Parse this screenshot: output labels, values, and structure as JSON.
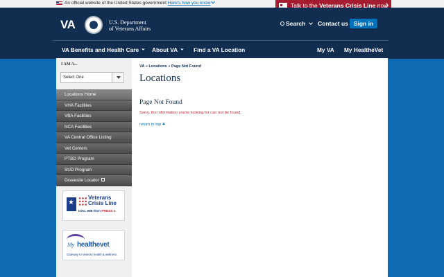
{
  "gov_banner": {
    "text": "An official website of the United States government",
    "link": "Here's how you know"
  },
  "crisis_line": {
    "prefix": "Talk to the",
    "bold": "Veterans Crisis Line",
    "suffix": "now"
  },
  "header": {
    "logo": "VA",
    "dept_line1": "U.S. Department",
    "dept_line2": "of Veterans Affairs",
    "search": "Search",
    "contact": "Contact us",
    "signin": "Sign in"
  },
  "nav": {
    "benefits": "VA Benefits and Health Care",
    "about": "About VA",
    "find": "Find a VA Location",
    "myva": "My VA",
    "myhealthevet": "My HealtheVet"
  },
  "sidebar": {
    "iam_label": "I AM A...",
    "select_value": "Select One",
    "items": [
      {
        "label": "Locations Home"
      },
      {
        "label": "VHA Facilities"
      },
      {
        "label": "VBA Facilities"
      },
      {
        "label": "NCA Facilities"
      },
      {
        "label": "VA Central Office Listing"
      },
      {
        "label": "Vet Centers"
      },
      {
        "label": "PTSD Program"
      },
      {
        "label": "SUD Program"
      },
      {
        "label": "Gravesite Locator"
      }
    ],
    "crisis_promo": {
      "line1": "Veterans",
      "line2": "Crisis Line",
      "dial": "DIAL 988 then",
      "press": "PRESS",
      "number": "1"
    },
    "mhv_promo": {
      "my": "My",
      "brand": "healthevet",
      "tagline": "Gateway to Veteran health & wellness"
    }
  },
  "content": {
    "breadcrumb": "VA » Locations » Page Not Found",
    "title": "Locations",
    "subtitle": "Page Not Found",
    "message": "Sorry, the information you're looking for can not be found.",
    "return_link": "return to top"
  },
  "colors": {
    "header_navy": "#112e51",
    "body_blue": "#0f6cb4",
    "crisis_red": "#a51c30",
    "link_blue": "#0071bb",
    "error_red": "#c4262e"
  }
}
